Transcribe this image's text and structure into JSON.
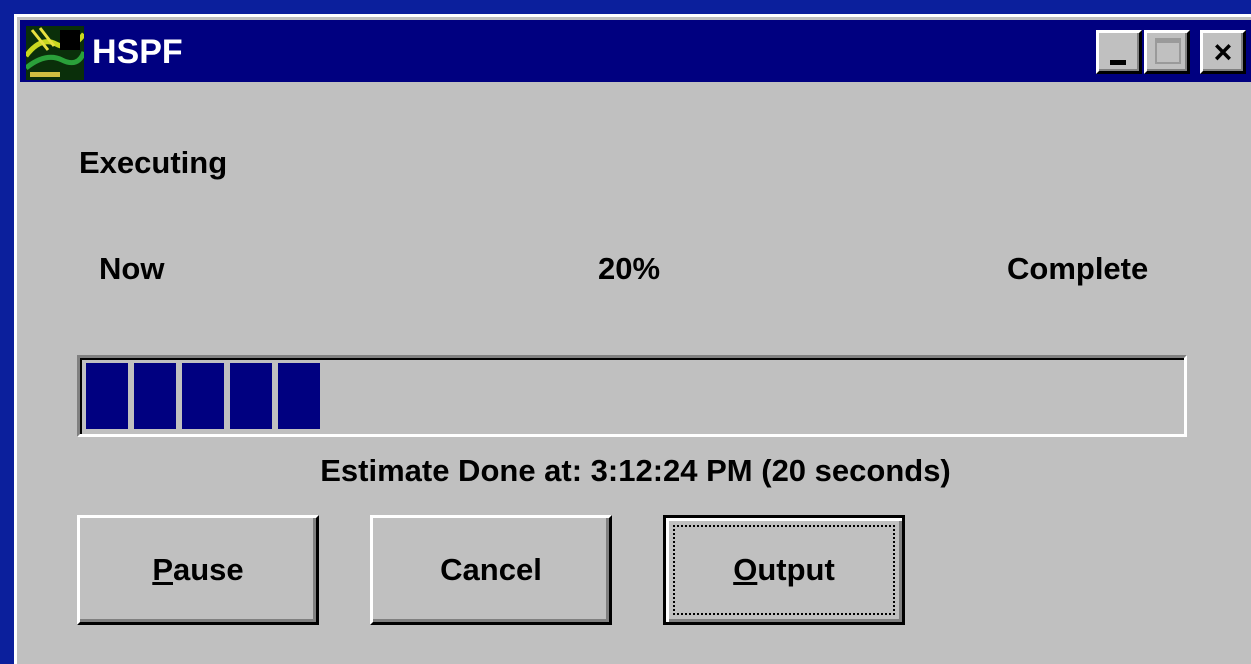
{
  "window": {
    "title": "HSPF",
    "icon": "hspf-app-icon",
    "controls": [
      "minimize-icon",
      "maximize-icon",
      "close-icon"
    ],
    "close_glyph": "×"
  },
  "status": {
    "heading": "Executing",
    "left_label": "Now",
    "percent_label": "20%",
    "right_label": "Complete",
    "progress_fraction": 0.2,
    "progress_color": "#000080",
    "estimate": "Estimate Done at: 3:12:24 PM  (20 seconds)"
  },
  "buttons": {
    "pause": {
      "mnemonic": "P",
      "rest": "ause"
    },
    "cancel": {
      "label": "Cancel"
    },
    "output": {
      "mnemonic": "O",
      "rest": "utput"
    }
  },
  "colors": {
    "desktop": "#0b1f9c",
    "titlebar": "#000080",
    "face": "#c0c0c0"
  }
}
